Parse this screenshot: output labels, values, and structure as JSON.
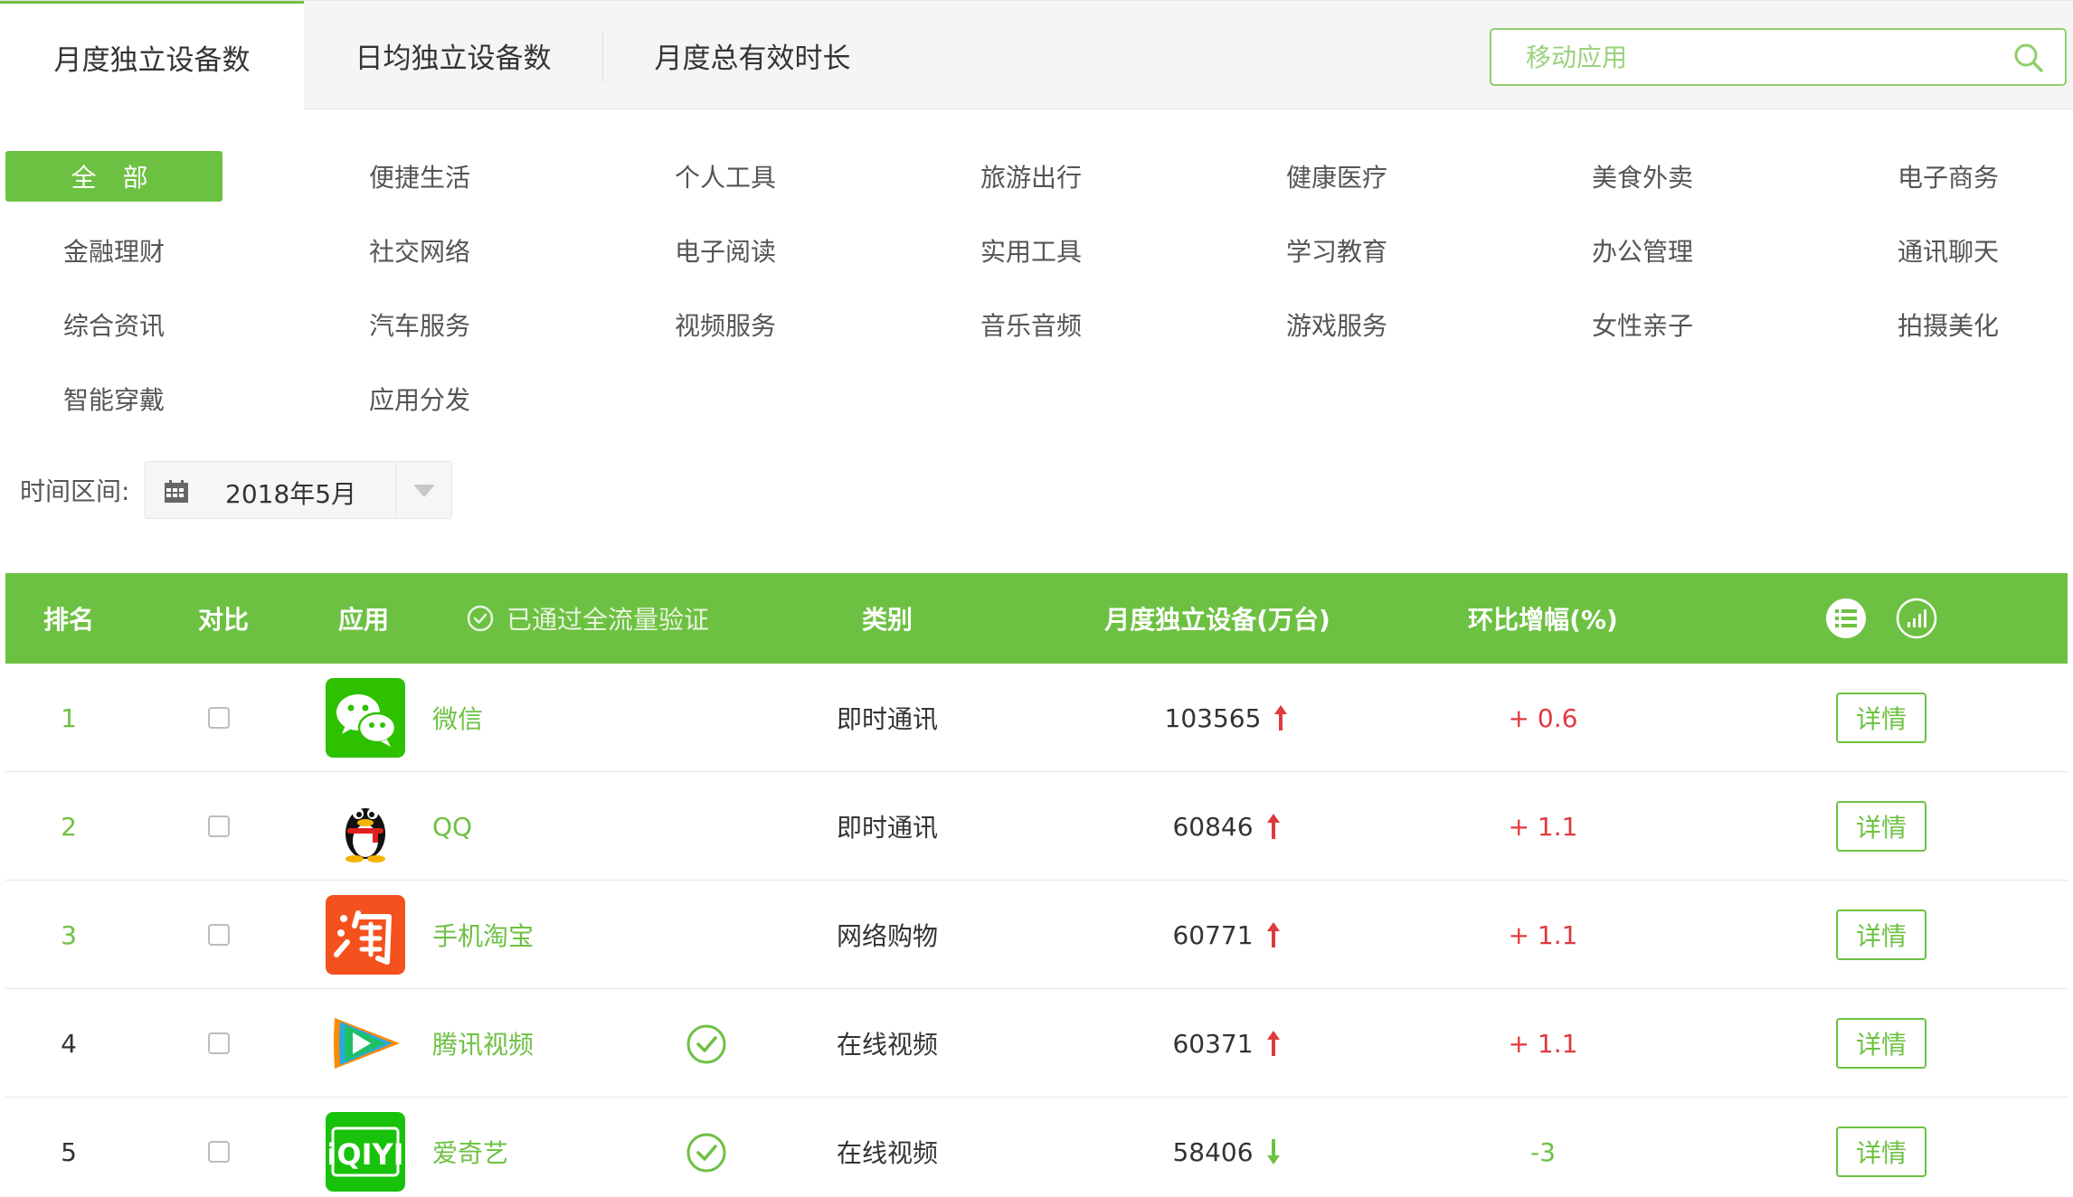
{
  "tabs": [
    "月度独立设备数",
    "日均独立设备数",
    "月度总有效时长"
  ],
  "search": {
    "placeholder": "移动应用"
  },
  "categories": [
    "全 部",
    "便捷生活",
    "个人工具",
    "旅游出行",
    "健康医疗",
    "美食外卖",
    "电子商务",
    "金融理财",
    "社交网络",
    "电子阅读",
    "实用工具",
    "学习教育",
    "办公管理",
    "通讯聊天",
    "综合资讯",
    "汽车服务",
    "视频服务",
    "音乐音频",
    "游戏服务",
    "女性亲子",
    "拍摄美化",
    "智能穿戴",
    "应用分发"
  ],
  "time": {
    "label": "时间区间:",
    "value": "2018年5月"
  },
  "table": {
    "headers": {
      "rank": "排名",
      "compare": "对比",
      "app": "应用",
      "verified": "已通过全流量验证",
      "category": "类别",
      "devices": "月度独立设备(万台)",
      "change": "环比增幅(%)"
    },
    "detail_label": "详情",
    "rows": [
      {
        "rank": "1",
        "app": "微信",
        "category": "即时通讯",
        "devices": "103565",
        "trend": "up",
        "change": "+ 0.6",
        "verified": false,
        "icon": "wechat-icon"
      },
      {
        "rank": "2",
        "app": "QQ",
        "category": "即时通讯",
        "devices": "60846",
        "trend": "up",
        "change": "+ 1.1",
        "verified": false,
        "icon": "qq-penguin-icon"
      },
      {
        "rank": "3",
        "app": "手机淘宝",
        "category": "网络购物",
        "devices": "60771",
        "trend": "up",
        "change": "+ 1.1",
        "verified": false,
        "icon": "taobao-icon"
      },
      {
        "rank": "4",
        "app": "腾讯视频",
        "category": "在线视频",
        "devices": "60371",
        "trend": "up",
        "change": "+ 1.1",
        "verified": true,
        "icon": "tencent-video-icon"
      },
      {
        "rank": "5",
        "app": "爱奇艺",
        "category": "在线视频",
        "devices": "58406",
        "trend": "down",
        "change": "-3",
        "verified": true,
        "icon": "iqiyi-icon"
      }
    ]
  },
  "colors": {
    "brand_green": "#6dc142",
    "up_red": "#e0393e",
    "text": "#333333"
  }
}
